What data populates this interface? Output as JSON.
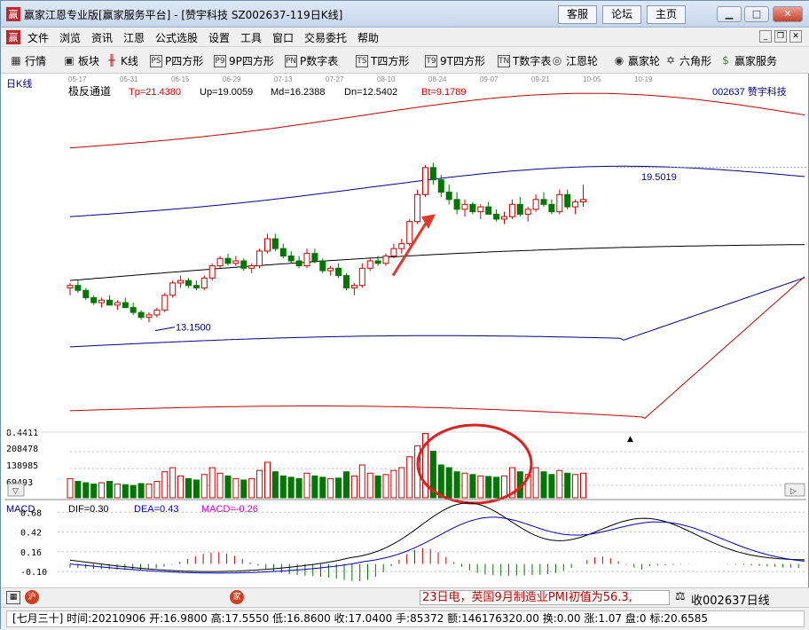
{
  "window": {
    "title": "赢家江恩专业版[赢家服务平台] - [赞宇科技  SZ002637-119日K线]",
    "top_buttons": [
      "客服",
      "论坛",
      "主页"
    ]
  },
  "menu": [
    "文件",
    "浏览",
    "资讯",
    "江恩",
    "公式选股",
    "设置",
    "工具",
    "窗口",
    "交易委托",
    "帮助"
  ],
  "toolbar": [
    {
      "label": "行情",
      "icon": "grid-icon"
    },
    {
      "label": "板块",
      "icon": "sector-icon"
    },
    {
      "label": "K线",
      "icon": "candle-icon"
    },
    {
      "label": "P四方形",
      "icon": "ps-icon",
      "code": "PS"
    },
    {
      "label": "9P四方形",
      "icon": "p9-icon",
      "code": "P9"
    },
    {
      "label": "P数字表",
      "icon": "pn-icon",
      "code": "PN"
    },
    {
      "label": "T四方形",
      "icon": "ts-icon",
      "code": "TS"
    },
    {
      "label": "9T四方形",
      "icon": "t9-icon",
      "code": "T9"
    },
    {
      "label": "T数字表",
      "icon": "tn-icon",
      "code": "TN"
    },
    {
      "label": "江恩轮",
      "icon": "gann-wheel-icon"
    },
    {
      "label": "赢家轮",
      "icon": "winner-wheel-icon"
    },
    {
      "label": "六角形",
      "icon": "hexagon-icon"
    },
    {
      "label": "赢家服务",
      "icon": "dollar-icon"
    }
  ],
  "chart": {
    "period_label": "日K线",
    "dates": [
      "05-17",
      "05-31",
      "06-15",
      "06-29",
      "07-13",
      "07-27",
      "08-10",
      "08-24",
      "09-07",
      "09-21",
      "10-05",
      "10-19"
    ],
    "indicator_name": "极反通道",
    "indicator_values": [
      {
        "name": "Tp",
        "value": "Tp=21.4380",
        "color": "#d00000"
      },
      {
        "name": "Up",
        "value": "Up=19.0059",
        "color": "#000000"
      },
      {
        "name": "Md",
        "value": "Md=16.2388",
        "color": "#000000"
      },
      {
        "name": "Dn",
        "value": "Dn=12.5402",
        "color": "#000000"
      },
      {
        "name": "Bt",
        "value": "Bt=9.1789",
        "color": "#d00000"
      }
    ],
    "stock_label": "002637  赞宇科技",
    "annotation_high": "19.5019",
    "annotation_low": "13.1500",
    "volume_axis": [
      "8.4411",
      "208478",
      "138985",
      "69493"
    ],
    "macd_name": "MACD",
    "macd_values": [
      {
        "label": "DIF=0.30",
        "color": "#000000"
      },
      {
        "label": "DEA=0.43",
        "color": "#0000cc"
      },
      {
        "label": "MACD=-0.26",
        "color": "#cc00cc"
      }
    ],
    "macd_axis": [
      "0.68",
      "0.42",
      "0.16",
      "-0.10"
    ]
  },
  "statusbar": {
    "ticker_text": "23日电，英国9月制造业PMI初值为56.3,",
    "right_text": "收002637日线"
  },
  "infobar": {
    "text": "[七月三十] 时间:20210906 开:16.9800 高:17.5550 低:16.8600 收:17.0400 手:85372 额:146176320.00 换:0.00 涨:1.07 盘:0 标:20.6585"
  },
  "chart_data": {
    "type": "candlestick",
    "x_ticks": [
      "05-17",
      "05-31",
      "06-15",
      "06-29",
      "07-13",
      "07-27",
      "08-10",
      "08-24",
      "09-07",
      "09-21",
      "10-05",
      "10-19"
    ],
    "ohlc": [
      [
        14.6,
        14.8,
        14.3,
        14.7
      ],
      [
        14.7,
        14.9,
        14.4,
        14.5
      ],
      [
        14.5,
        14.6,
        14.1,
        14.2
      ],
      [
        14.2,
        14.3,
        13.9,
        14.0
      ],
      [
        14.0,
        14.2,
        13.8,
        14.1
      ],
      [
        14.1,
        14.3,
        13.9,
        13.9
      ],
      [
        13.9,
        14.1,
        13.7,
        14.0
      ],
      [
        14.0,
        14.2,
        13.8,
        13.8
      ],
      [
        13.8,
        14.0,
        13.5,
        13.6
      ],
      [
        13.6,
        13.7,
        13.3,
        13.4
      ],
      [
        13.4,
        13.6,
        13.2,
        13.5
      ],
      [
        13.5,
        13.8,
        13.4,
        13.7
      ],
      [
        13.7,
        14.4,
        13.6,
        14.3
      ],
      [
        14.3,
        14.9,
        14.2,
        14.8
      ],
      [
        14.8,
        15.1,
        14.6,
        14.9
      ],
      [
        14.9,
        15.0,
        14.6,
        14.7
      ],
      [
        14.7,
        14.9,
        14.5,
        14.6
      ],
      [
        14.6,
        15.1,
        14.5,
        15.0
      ],
      [
        15.0,
        15.6,
        14.9,
        15.5
      ],
      [
        15.5,
        15.9,
        15.4,
        15.8
      ],
      [
        15.8,
        16.0,
        15.5,
        15.6
      ],
      [
        15.6,
        15.9,
        15.5,
        15.7
      ],
      [
        15.7,
        15.8,
        15.3,
        15.4
      ],
      [
        15.4,
        15.6,
        15.2,
        15.5
      ],
      [
        15.5,
        16.2,
        15.4,
        16.1
      ],
      [
        16.1,
        16.8,
        16.0,
        16.6
      ],
      [
        16.6,
        16.8,
        16.1,
        16.2
      ],
      [
        16.2,
        16.4,
        15.8,
        15.9
      ],
      [
        15.9,
        16.1,
        15.6,
        15.7
      ],
      [
        15.7,
        15.9,
        15.4,
        15.5
      ],
      [
        15.5,
        16.2,
        15.4,
        16.0
      ],
      [
        16.0,
        16.2,
        15.6,
        15.7
      ],
      [
        15.7,
        15.8,
        15.2,
        15.3
      ],
      [
        15.3,
        15.5,
        15.1,
        15.4
      ],
      [
        15.4,
        15.6,
        15.0,
        15.1
      ],
      [
        15.1,
        15.2,
        14.5,
        14.6
      ],
      [
        14.6,
        14.8,
        14.3,
        14.7
      ],
      [
        14.7,
        15.6,
        14.6,
        15.4
      ],
      [
        15.4,
        15.8,
        15.3,
        15.7
      ],
      [
        15.7,
        15.9,
        15.5,
        15.6
      ],
      [
        15.6,
        16.0,
        15.5,
        15.9
      ],
      [
        15.9,
        16.4,
        15.8,
        16.2
      ],
      [
        16.2,
        16.6,
        16.0,
        16.4
      ],
      [
        16.4,
        17.4,
        16.3,
        17.3
      ],
      [
        17.3,
        18.6,
        17.2,
        18.4
      ],
      [
        18.4,
        19.6,
        18.3,
        19.5
      ],
      [
        19.5,
        19.7,
        18.8,
        19.0
      ],
      [
        19.0,
        19.2,
        18.3,
        18.5
      ],
      [
        18.5,
        18.8,
        18.0,
        18.2
      ],
      [
        18.2,
        18.5,
        17.6,
        17.8
      ],
      [
        17.8,
        18.2,
        17.5,
        18.0
      ],
      [
        18.0,
        18.1,
        17.6,
        17.7
      ],
      [
        17.7,
        18.0,
        17.4,
        17.9
      ],
      [
        17.9,
        18.1,
        17.6,
        17.6
      ],
      [
        17.6,
        17.8,
        17.3,
        17.4
      ],
      [
        17.4,
        17.7,
        17.2,
        17.5
      ],
      [
        17.5,
        18.2,
        17.4,
        18.0
      ],
      [
        18.0,
        18.3,
        17.5,
        17.6
      ],
      [
        17.6,
        17.9,
        17.3,
        17.8
      ],
      [
        17.8,
        18.4,
        17.7,
        18.2
      ],
      [
        18.2,
        18.5,
        17.9,
        18.0
      ],
      [
        18.0,
        18.2,
        17.6,
        17.7
      ],
      [
        17.7,
        18.6,
        17.6,
        18.4
      ],
      [
        18.4,
        18.6,
        17.8,
        17.9
      ],
      [
        17.9,
        18.2,
        17.6,
        18.1
      ],
      [
        18.1,
        18.8,
        17.9,
        18.2
      ]
    ],
    "upper_outer_start": 20.3,
    "upper_outer_end": 21.44,
    "upper_start": 17.5,
    "upper_end": 19.0,
    "mid_start": 14.9,
    "mid_end": 16.24,
    "lower_start": 12.2,
    "lower_end": 12.54,
    "lower_outer_start": 9.6,
    "lower_outer_end": 9.18,
    "volume_ylim": [
      0,
      240000
    ],
    "macd_ylim": [
      -0.25,
      0.8
    ]
  }
}
